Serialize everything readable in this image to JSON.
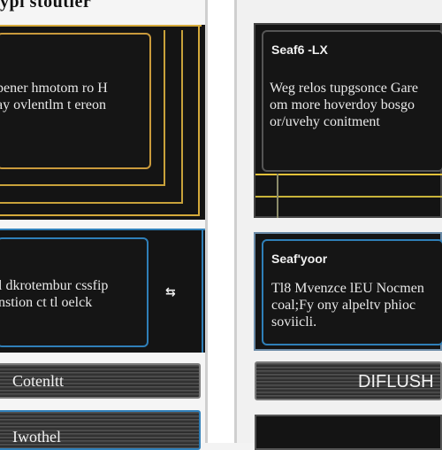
{
  "page_title": "ypl stoutier",
  "left": {
    "panel1": {
      "text": "pener hmotom ro H\nay ovlentlm t ereon"
    },
    "panel2": {
      "text": "l dkrotembur cssfip\nnstion ct tl oelck"
    },
    "arrow_icon": "double-arrow-icon",
    "bar1_label": "Cotenltt",
    "bar2_label": "Iwothel"
  },
  "right": {
    "panel1": {
      "header": "Seaf6 -LX",
      "text": "Weg relos tupgsonce Gare\nom more hoverdoy bosgo\nor/uvehy conitment"
    },
    "panel2": {
      "header": "Seaf'yoor",
      "text": "Tl8 Mvenzce lEU Nocmen\ncoal;Fy ony alpeltv phioc\nsoviicli."
    },
    "bar1_label": "DIFLUSH"
  },
  "colors": {
    "gold": "#d4a93a",
    "yellow": "#e3c23a",
    "blue": "#2f7fb8",
    "steel": "#6a8aa6"
  }
}
